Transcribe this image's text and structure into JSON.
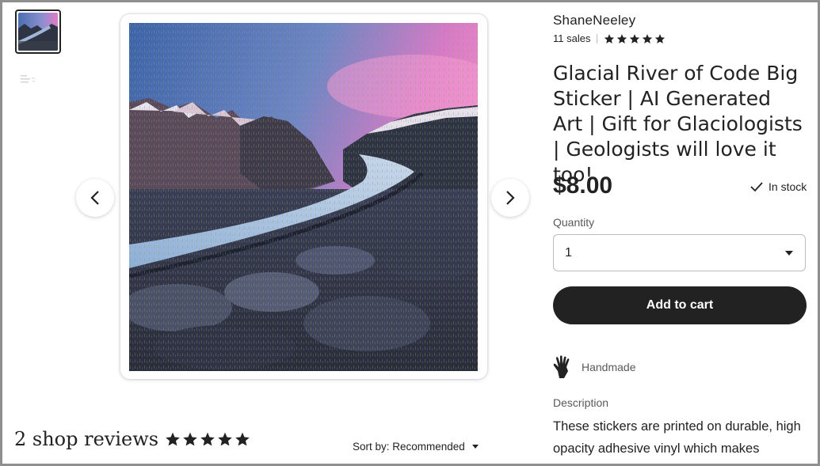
{
  "shop": {
    "name": "ShaneNeeley",
    "sales": "11 sales",
    "rating": 5
  },
  "listing": {
    "title": "Glacial River of Code Big Sticker | AI Generated Art | Gift for Glaciologists | Geologists will love it too!",
    "price": "$8.00",
    "stock": "In stock"
  },
  "quantity": {
    "label": "Quantity",
    "value": "1"
  },
  "cart": {
    "button_label": "Add to cart"
  },
  "highlights": {
    "handmade": "Handmade"
  },
  "description": {
    "label": "Description",
    "text": "These stickers are printed on durable, high opacity adhesive vinyl which makes"
  },
  "reviews": {
    "title": "2 shop reviews",
    "rating": 5
  },
  "sort": {
    "label": "Sort by: Recommended"
  },
  "icons": {
    "prev": "chevron-left-icon",
    "next": "chevron-right-icon",
    "check": "check-icon",
    "dropdown": "caret-down-icon",
    "handmade": "hand-icon",
    "star": "star-icon"
  },
  "colors": {
    "primary_button": "#222222",
    "text": "#222222",
    "muted": "#595959"
  }
}
